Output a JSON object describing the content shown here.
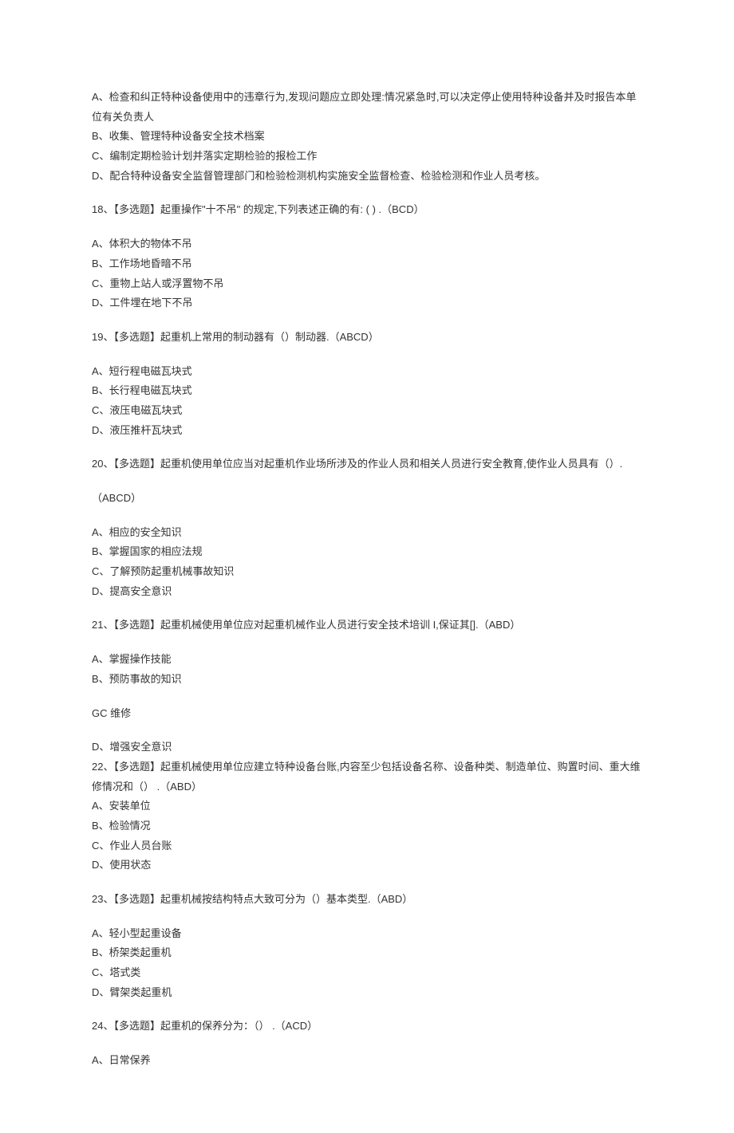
{
  "q17_options": {
    "a": "A、检查和纠正特种设备使用中的违章行为,发现问题应立即处理:情况紧急时,可以决定停止使用特种设备并及时报告本单位有关负责人",
    "b": "B、收集、管理特种设备安全技术档案",
    "c": "C、编制定期检验计划并落实定期检验的报检工作",
    "d": "D、配合特种设备安全监督管理部门和检验检测机构实施安全监督检查、检验检测和作业人员考核。"
  },
  "q18": {
    "stem": "18、【多选题】起重操作\"十不吊\" 的规定,下列表述正确的有: ( ) .（BCD）",
    "a": "A、体积大的物体不吊",
    "b": "B、工作场地昏暗不吊",
    "c": "C、重物上站人或浮置物不吊",
    "d": "D、工件埋在地下不吊"
  },
  "q19": {
    "stem": "19、【多选题】起重机上常用的制动器有（）制动器.（ABCD）",
    "a": "A、短行程电磁瓦块式",
    "b": "B、长行程电磁瓦块式",
    "c": "C、液压电磁瓦块式",
    "d": "D、液压推杆瓦块式"
  },
  "q20": {
    "stem": "20、【多选题】起重机使用单位应当对起重机作业场所涉及的作业人员和相关人员进行安全教育,使作业人员具有（）.",
    "ans": "（ABCD）",
    "a": "A、相应的安全知识",
    "b": "B、掌握国家的相应法规",
    "c": "C、了解预防起重机械事故知识",
    "d": "D、提高安全意识"
  },
  "q21": {
    "stem": "21、【多选题】起重机械使用单位应对起重机械作业人员进行安全技术培训 I,保证其[].（ABD）",
    "a": "A、掌握操作技能",
    "b": "B、预防事故的知识",
    "gc": "GC 维修",
    "d": "D、增强安全意识"
  },
  "q22": {
    "stem": "22、【多选题】起重机械使用单位应建立特种设备台账,内容至少包括设备名称、设备种类、制造单位、购置时间、重大维修情况和（） .（ABD）",
    "a": "A、安装单位",
    "b": "B、检验情况",
    "c": "C、作业人员台账",
    "d": "D、使用状态"
  },
  "q23": {
    "stem": "23、【多选题】起重机械按结构特点大致可分为（）基本类型.（ABD）",
    "a": "A、轻小型起重设备",
    "b": "B、桥架类起重机",
    "c": "C、塔式类",
    "d": "D、臂架类起重机"
  },
  "q24": {
    "stem": "24、【多选题】起重机的保养分为：（） .（ACD）",
    "a": "A、日常保养"
  }
}
